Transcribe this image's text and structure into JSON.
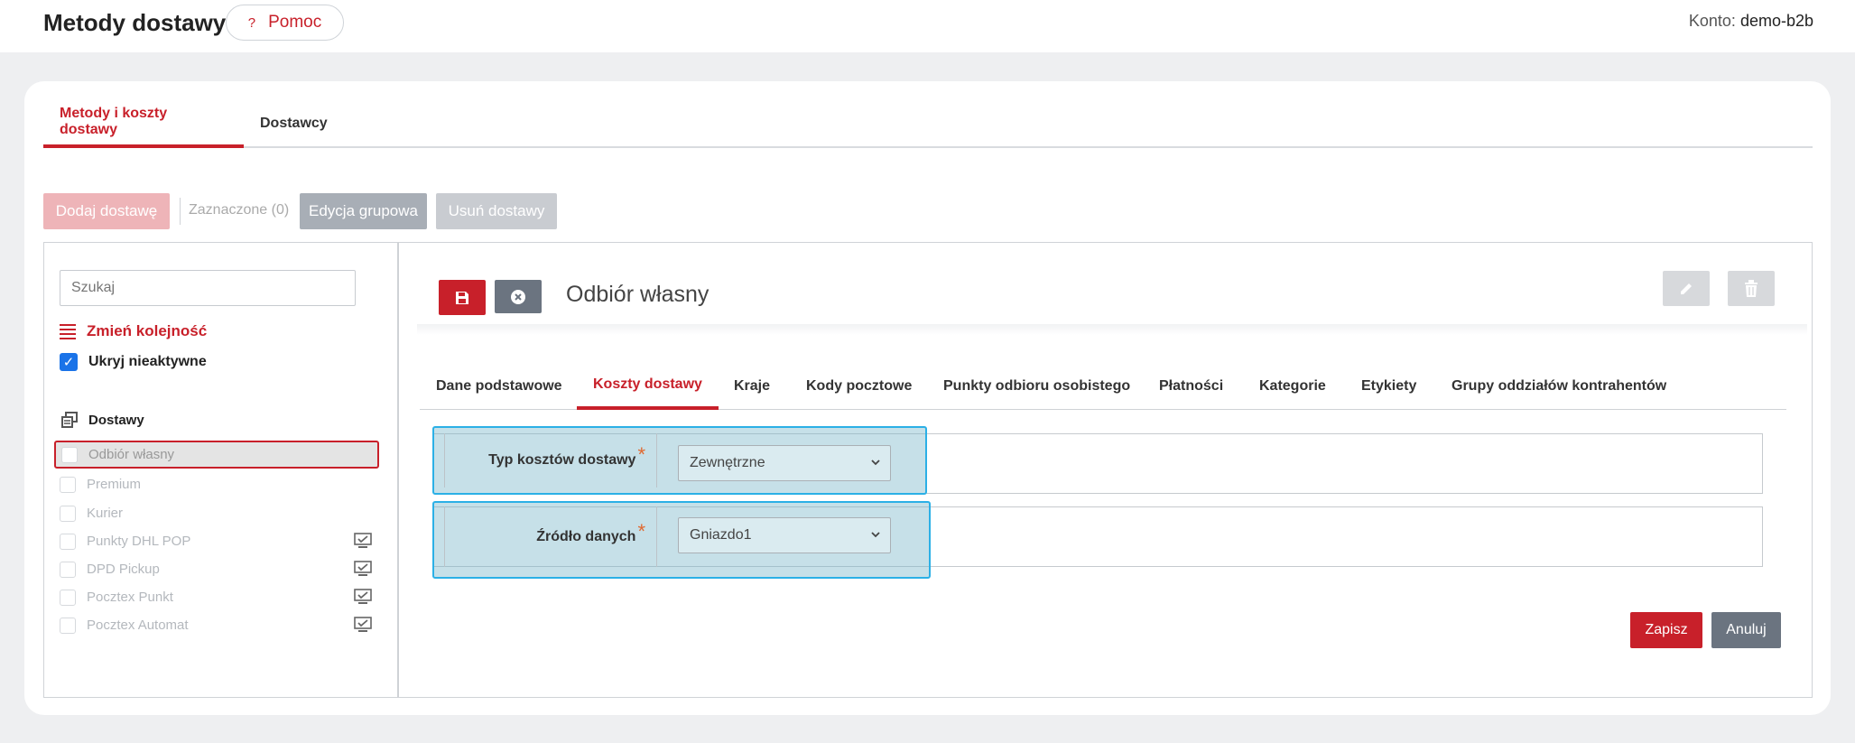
{
  "header": {
    "title": "Metody dostawy",
    "help_label": "Pomoc",
    "help_icon_glyph": "?",
    "account_label": "Konto:",
    "account_name": "demo-b2b"
  },
  "main_tabs": [
    {
      "label": "Metody i koszty dostawy",
      "active": true
    },
    {
      "label": "Dostawcy",
      "active": false
    }
  ],
  "toolbar": {
    "add_label": "Dodaj dostawę",
    "selected_label": "Zaznaczone (0)",
    "group_edit_label": "Edycja grupowa",
    "delete_label": "Usuń dostawy"
  },
  "sidebar": {
    "search_placeholder": "Szukaj",
    "reorder_label": "Zmień kolejność",
    "hide_inactive_label": "Ukryj nieaktywne",
    "hide_inactive_checked": true,
    "list_heading": "Dostawy",
    "items": [
      {
        "label": "Odbiór własny",
        "selected": true,
        "monitor_icon": false
      },
      {
        "label": "Premium",
        "selected": false,
        "monitor_icon": false
      },
      {
        "label": "Kurier",
        "selected": false,
        "monitor_icon": false
      },
      {
        "label": "Punkty DHL POP",
        "selected": false,
        "monitor_icon": true
      },
      {
        "label": "DPD Pickup",
        "selected": false,
        "monitor_icon": true
      },
      {
        "label": "Pocztex Punkt",
        "selected": false,
        "monitor_icon": true
      },
      {
        "label": "Pocztex Automat",
        "selected": false,
        "monitor_icon": true
      }
    ]
  },
  "detail": {
    "title": "Odbiór własny",
    "tabs": [
      {
        "label": "Dane podstawowe",
        "active": false
      },
      {
        "label": "Koszty dostawy",
        "active": true
      },
      {
        "label": "Kraje",
        "active": false
      },
      {
        "label": "Kody pocztowe",
        "active": false
      },
      {
        "label": "Punkty odbioru osobistego",
        "active": false
      },
      {
        "label": "Płatności",
        "active": false
      },
      {
        "label": "Kategorie",
        "active": false
      },
      {
        "label": "Etykiety",
        "active": false
      },
      {
        "label": "Grupy oddziałów kontrahentów",
        "active": false
      }
    ],
    "fields": [
      {
        "label": "Typ kosztów dostawy",
        "required_mark": "*",
        "value": "Zewnętrzne"
      },
      {
        "label": "Źródło danych",
        "required_mark": "*",
        "value": "Gniazdo1"
      }
    ],
    "save_label": "Zapisz",
    "cancel_label": "Anuluj"
  },
  "colors": {
    "accent": "#c8202a",
    "secondary": "#6b7480",
    "highlight_border": "#2bb0e6"
  }
}
